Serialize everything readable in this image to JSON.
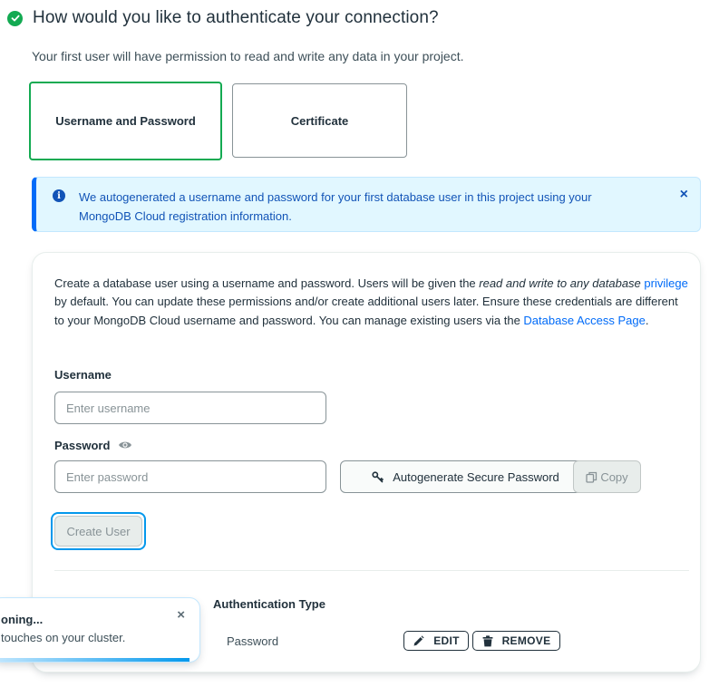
{
  "step": {
    "title": "How would you like to authenticate your connection?",
    "description": "Your first user will have permission to read and write any data in your project."
  },
  "auth_options": [
    {
      "label": "Username and Password",
      "selected": true
    },
    {
      "label": "Certificate",
      "selected": false
    }
  ],
  "banner": {
    "icon": "info-icon",
    "text": "We autogenerated a username and password for your first database user in this project using your MongoDB Cloud registration information.",
    "close": "×"
  },
  "card": {
    "desc_1": "Create a database user using a username and password. Users will be given the ",
    "desc_em": "read and write to any database",
    "desc_link1": "privilege",
    "desc_2": " by default. You can update these permissions and/or create additional users later. Ensure these credentials are different to your MongoDB Cloud username and password. You can manage existing users via the ",
    "desc_link2": "Database Access Page",
    "desc_3": "."
  },
  "form": {
    "username_label": "Username",
    "username_placeholder": "Enter username",
    "username_value": "",
    "password_label": "Password",
    "password_placeholder": "Enter password",
    "password_value": "",
    "autogen_label": "Autogenerate Secure Password",
    "copy_label": "Copy",
    "create_label": "Create User"
  },
  "users_table": {
    "header_auth_type": "Authentication Type",
    "rows": [
      {
        "auth_type": "Password",
        "edit_label": "EDIT",
        "remove_label": "REMOVE"
      }
    ]
  },
  "toast": {
    "title": "oning...",
    "body": "touches on your cluster.",
    "close": "×",
    "progress": 0.95
  },
  "colors": {
    "accent_green": "#13aa52",
    "info_blue": "#1254b7",
    "link_blue": "#016bf8",
    "focus_ring": "#0498ec"
  }
}
